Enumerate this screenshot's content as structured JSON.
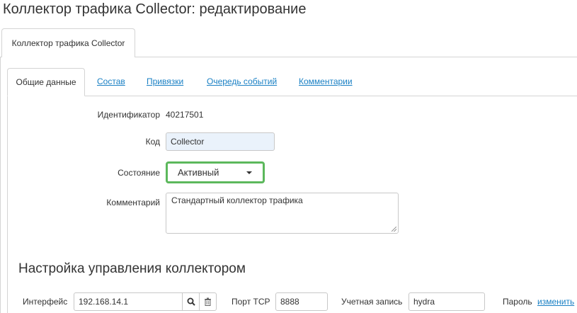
{
  "page": {
    "title": "Коллектор трафика Collector: редактирование"
  },
  "outer_tabs": [
    {
      "label": "Коллектор трафика Collector"
    }
  ],
  "inner_tabs": [
    {
      "label": "Общие данные",
      "active": true
    },
    {
      "label": "Состав"
    },
    {
      "label": "Привязки"
    },
    {
      "label": "Очередь событий"
    },
    {
      "label": "Комментарии"
    }
  ],
  "form": {
    "id_label": "Идентификатор",
    "id_value": "40217501",
    "code_label": "Код",
    "code_value": "Collector",
    "state_label": "Состояние",
    "state_value": "Активный",
    "comment_label": "Комментарий",
    "comment_value": "Стандартный коллектор трафика"
  },
  "management": {
    "title": "Настройка управления коллектором",
    "interface_label": "Интерфейс",
    "interface_value": "192.168.14.1",
    "port_label": "Порт TCP",
    "port_value": "8888",
    "account_label": "Учетная запись",
    "account_value": "hydra",
    "password_label": "Пароль",
    "password_link": "изменить"
  },
  "colors": {
    "link": "#1a80c4",
    "highlight_border": "#5cb85c",
    "input_autofill": "#eaf2fb"
  }
}
